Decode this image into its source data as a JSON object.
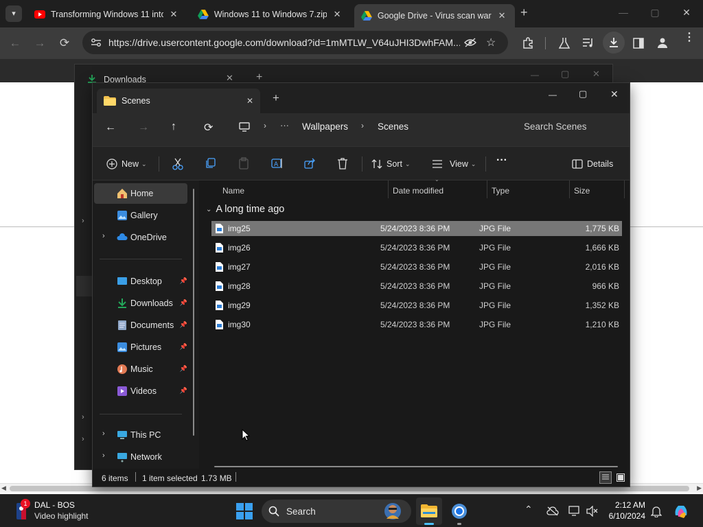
{
  "browser": {
    "tabs": [
      {
        "title": "Transforming Windows 11 into",
        "favicon": "youtube-icon"
      },
      {
        "title": "Windows 11 to Windows 7.zip",
        "favicon": "google-drive-icon"
      },
      {
        "title": "Google Drive - Virus scan warn",
        "favicon": "google-drive-icon"
      }
    ],
    "url": "https://drive.usercontent.google.com/download?id=1mMTLW_V64uJHI3DwhFAM..."
  },
  "background_window": {
    "title": "Downloads"
  },
  "explorer": {
    "tab_title": "Scenes",
    "breadcrumb": [
      "Wallpapers",
      "Scenes"
    ],
    "search_placeholder": "Search Scenes",
    "commands": {
      "new": "New",
      "sort": "Sort",
      "view": "View",
      "details": "Details"
    },
    "nav": {
      "home": "Home",
      "gallery": "Gallery",
      "onedrive": "OneDrive",
      "desktop": "Desktop",
      "downloads": "Downloads",
      "documents": "Documents",
      "pictures": "Pictures",
      "music": "Music",
      "videos": "Videos",
      "thispc": "This PC",
      "network": "Network"
    },
    "columns": {
      "name": "Name",
      "date": "Date modified",
      "type": "Type",
      "size": "Size"
    },
    "group_label": "A long time ago",
    "files": [
      {
        "name": "img25",
        "date": "5/24/2023 8:36 PM",
        "type": "JPG File",
        "size": "1,775 KB"
      },
      {
        "name": "img26",
        "date": "5/24/2023 8:36 PM",
        "type": "JPG File",
        "size": "1,666 KB"
      },
      {
        "name": "img27",
        "date": "5/24/2023 8:36 PM",
        "type": "JPG File",
        "size": "2,016 KB"
      },
      {
        "name": "img28",
        "date": "5/24/2023 8:36 PM",
        "type": "JPG File",
        "size": "966 KB"
      },
      {
        "name": "img29",
        "date": "5/24/2023 8:36 PM",
        "type": "JPG File",
        "size": "1,352 KB"
      },
      {
        "name": "img30",
        "date": "5/24/2023 8:36 PM",
        "type": "JPG File",
        "size": "1,210 KB"
      }
    ],
    "status": {
      "count": "6 items",
      "selection": "1 item selected",
      "size": "1.73 MB"
    }
  },
  "taskbar": {
    "widget_title": "DAL - BOS",
    "widget_subtitle": "Video highlight",
    "widget_badge": "1",
    "search_label": "Search",
    "time": "2:12 AM",
    "date": "6/10/2024"
  },
  "colors": {
    "accent": "#0078d4",
    "selection": "#777777",
    "dark_bg": "#191919"
  }
}
